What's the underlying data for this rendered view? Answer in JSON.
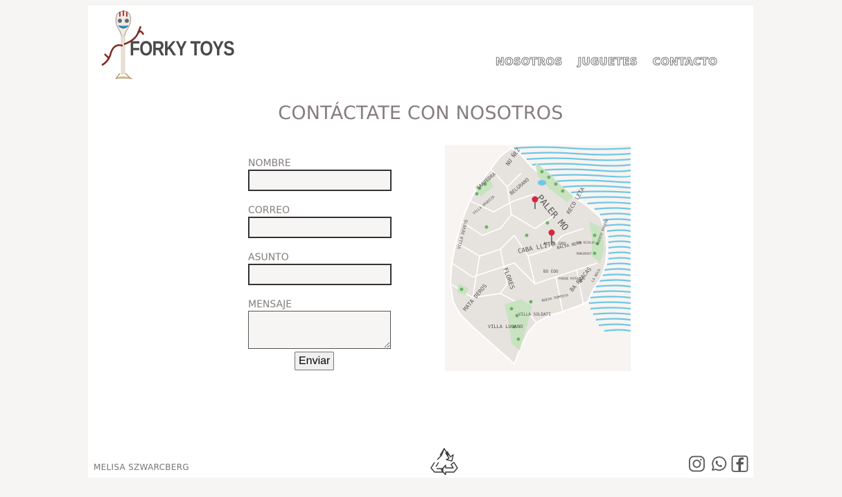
{
  "brand": {
    "name": "FORKY TOYS"
  },
  "nav": {
    "items": [
      "NOSOTROS",
      "JUGUETES",
      "CONTACTO"
    ]
  },
  "heading": "CONTÁCTATE CON NOSOTROS",
  "form": {
    "fields": [
      {
        "label": "NOMBRE",
        "value": ""
      },
      {
        "label": "CORREO",
        "value": ""
      },
      {
        "label": "ASUNTO",
        "value": ""
      },
      {
        "label": "MENSAJE",
        "value": ""
      }
    ],
    "submit_label": "Enviar"
  },
  "map": {
    "labels": [
      "NU ÑEZ",
      "SAAVEDRA",
      "BELGRANO",
      "VILLA URQUIZA",
      "PALER MO",
      "RECO LETA",
      "VILLA DEVOTO",
      "CABA LLITO",
      "FLORES",
      "AL MA GRO",
      "BALVA NERA",
      "PUERTO MADERO",
      "BO EDO",
      "BA RRACAS",
      "LA BOCA",
      "MATA DEROS",
      "VILLA SOLDATI",
      "VILLA LUGANO",
      "NUEVA POMPEYA",
      "SAN NICOLAS",
      "MONSERRAT",
      "PARQUE PATRICIOS"
    ],
    "colors": {
      "land": "#e6e2de",
      "park": "#c9e3c1",
      "water": "#6fc6e6",
      "pin": "#d7263d"
    }
  },
  "footer": {
    "author": "MELISA SZWARCBERG",
    "recycle_icon": "recycle-icon",
    "socials": [
      "instagram-icon",
      "whatsapp-icon",
      "facebook-icon"
    ]
  }
}
